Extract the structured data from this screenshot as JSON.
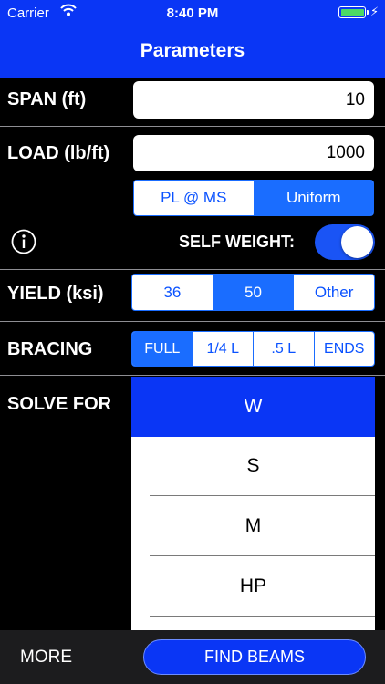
{
  "status_bar": {
    "carrier": "Carrier",
    "time": "8:40 PM"
  },
  "nav": {
    "title": "Parameters"
  },
  "span": {
    "label": "SPAN (ft)",
    "value": "10"
  },
  "load": {
    "label": "LOAD (lb/ft)",
    "value": "1000",
    "options": [
      "PL @ MS",
      "Uniform"
    ],
    "selected": "Uniform"
  },
  "self_weight": {
    "label": "SELF WEIGHT:",
    "on": true
  },
  "yield": {
    "label": "YIELD (ksi)",
    "options": [
      "36",
      "50",
      "Other"
    ],
    "selected": "50"
  },
  "bracing": {
    "label": "BRACING",
    "options": [
      "FULL",
      "1/4 L",
      ".5 L",
      "ENDS"
    ],
    "selected": "FULL"
  },
  "solve_for": {
    "label": "SOLVE FOR",
    "items": [
      "W",
      "S",
      "M",
      "HP"
    ],
    "selected": "W"
  },
  "bottom": {
    "more_label": "MORE",
    "find_label": "FIND BEAMS"
  },
  "colors": {
    "accent": "#0a36f5",
    "segment": "#1a6dff",
    "battery": "#4cd964"
  },
  "icons": [
    "wifi-icon",
    "battery-icon",
    "charging-bolt-icon",
    "info-icon"
  ]
}
